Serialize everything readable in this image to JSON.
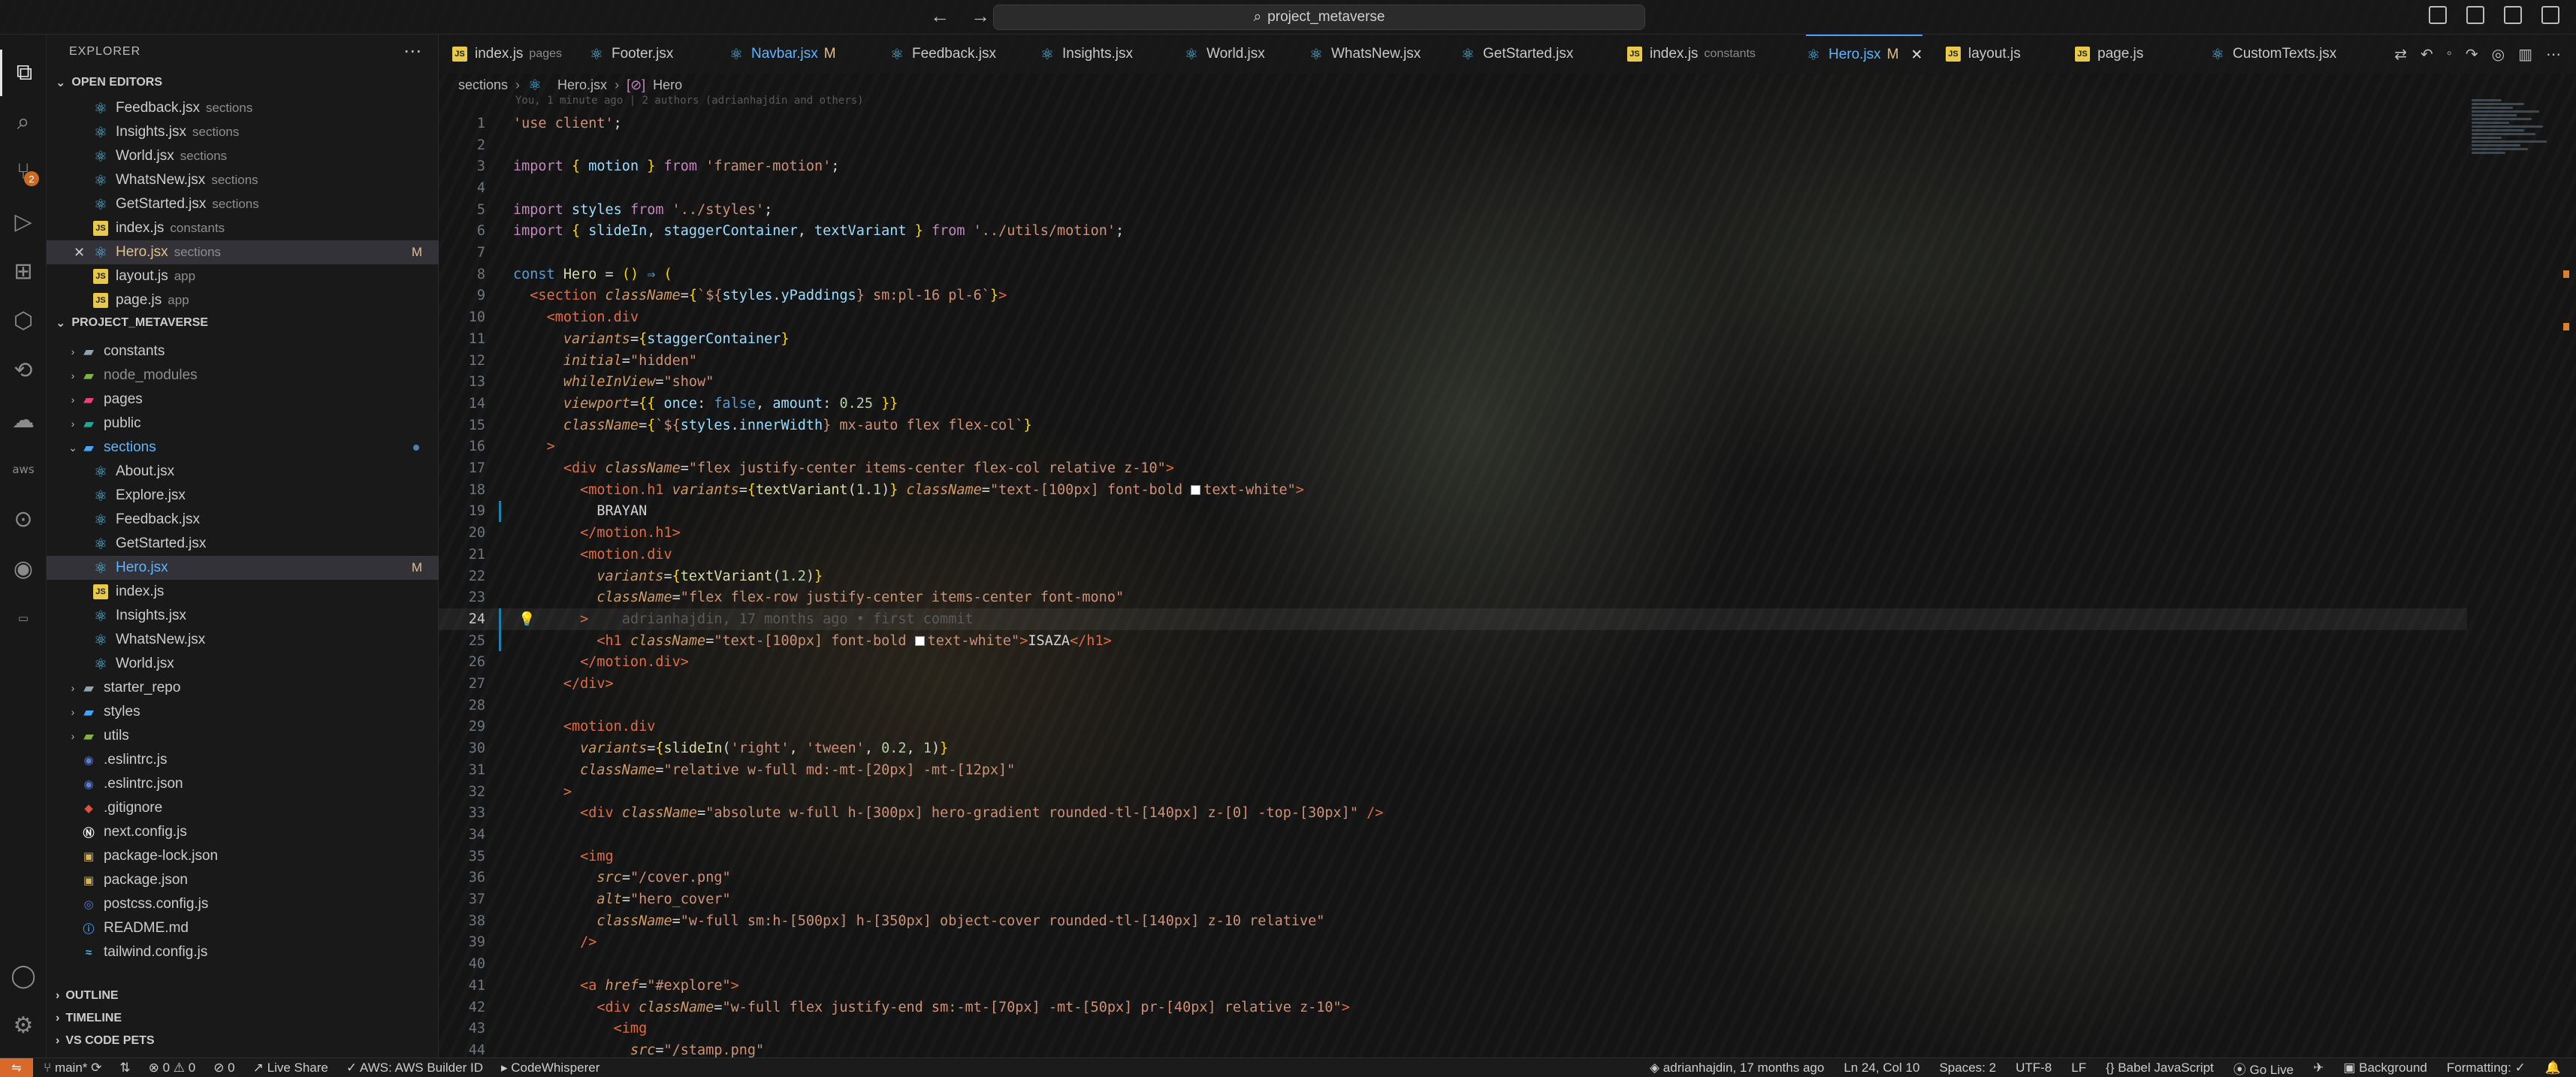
{
  "window": {
    "search_text": "project_metaverse"
  },
  "explorer": {
    "title": "EXPLORER",
    "open_editors_label": "OPEN EDITORS",
    "open_editors": [
      {
        "name": "Feedback.jsx",
        "desc": "sections",
        "icon": "react-icon"
      },
      {
        "name": "Insights.jsx",
        "desc": "sections",
        "icon": "react-icon"
      },
      {
        "name": "World.jsx",
        "desc": "sections",
        "icon": "react-icon"
      },
      {
        "name": "WhatsNew.jsx",
        "desc": "sections",
        "icon": "react-icon"
      },
      {
        "name": "GetStarted.jsx",
        "desc": "sections",
        "icon": "react-icon"
      },
      {
        "name": "index.js",
        "desc": "constants",
        "icon": "js-icon"
      },
      {
        "name": "Hero.jsx",
        "desc": "sections",
        "icon": "react-icon",
        "modified": "M"
      },
      {
        "name": "layout.js",
        "desc": "app",
        "icon": "js-icon"
      },
      {
        "name": "page.js",
        "desc": "app",
        "icon": "js-icon"
      }
    ],
    "project_label": "PROJECT_METAVERSE",
    "tree": [
      {
        "name": "constants",
        "type": "folder"
      },
      {
        "name": "node_modules",
        "type": "folder"
      },
      {
        "name": "pages",
        "type": "folder"
      },
      {
        "name": "public",
        "type": "folder"
      },
      {
        "name": "sections",
        "type": "folder-open"
      },
      {
        "name": "About.jsx",
        "type": "react"
      },
      {
        "name": "Explore.jsx",
        "type": "react"
      },
      {
        "name": "Feedback.jsx",
        "type": "react"
      },
      {
        "name": "GetStarted.jsx",
        "type": "react"
      },
      {
        "name": "Hero.jsx",
        "type": "react",
        "modified": "M"
      },
      {
        "name": "index.js",
        "type": "js"
      },
      {
        "name": "Insights.jsx",
        "type": "react"
      },
      {
        "name": "WhatsNew.jsx",
        "type": "react"
      },
      {
        "name": "World.jsx",
        "type": "react"
      },
      {
        "name": "starter_repo",
        "type": "folder"
      },
      {
        "name": "styles",
        "type": "folder"
      },
      {
        "name": "utils",
        "type": "folder"
      },
      {
        "name": ".eslintrc.js",
        "type": "cfg"
      },
      {
        "name": ".eslintrc.json",
        "type": "cfg"
      },
      {
        "name": ".gitignore",
        "type": "git"
      },
      {
        "name": "next.config.js",
        "type": "n"
      },
      {
        "name": "package-lock.json",
        "type": "json"
      },
      {
        "name": "package.json",
        "type": "json"
      },
      {
        "name": "postcss.config.js",
        "type": "cfg"
      },
      {
        "name": "README.md",
        "type": "info"
      },
      {
        "name": "tailwind.config.js",
        "type": "tw"
      }
    ],
    "outline_label": "OUTLINE",
    "timeline_label": "TIMELINE",
    "vscode_pets_label": "VS CODE PETS"
  },
  "tabs": [
    {
      "name": "index.js",
      "desc": "pages"
    },
    {
      "name": "Footer.jsx",
      "desc": ""
    },
    {
      "name": "Navbar.jsx",
      "desc": "",
      "modified": "M"
    },
    {
      "name": "Feedback.jsx",
      "desc": ""
    },
    {
      "name": "Insights.jsx",
      "desc": ""
    },
    {
      "name": "World.jsx",
      "desc": ""
    },
    {
      "name": "WhatsNew.jsx",
      "desc": ""
    },
    {
      "name": "GetStarted.jsx",
      "desc": ""
    },
    {
      "name": "index.js",
      "desc": "constants"
    },
    {
      "name": "Hero.jsx",
      "desc": "",
      "modified": "M",
      "active": true
    },
    {
      "name": "layout.js",
      "desc": ""
    },
    {
      "name": "page.js",
      "desc": ""
    },
    {
      "name": "CustomTexts.jsx",
      "desc": ""
    }
  ],
  "breadcrumb": {
    "folder": "sections",
    "file": "Hero.jsx",
    "symbol": "Hero"
  },
  "editor": {
    "blame_hint": "You, 1 minute ago | 2 authors (adrianhajdin and others)",
    "current_line": 24,
    "inline_blame": "adrianhajdin, 17 months ago • first commit",
    "line_numbers": [
      "1",
      "2",
      "3",
      "4",
      "5",
      "6",
      "7",
      "8",
      "9",
      "10",
      "11",
      "12",
      "13",
      "14",
      "15",
      "16",
      "17",
      "18",
      "19",
      "20",
      "21",
      "22",
      "23",
      "24",
      "25",
      "26",
      "27",
      "28",
      "29",
      "30",
      "31",
      "32",
      "33",
      "34",
      "35",
      "36",
      "37",
      "38",
      "39",
      "40",
      "41",
      "42",
      "43",
      "44"
    ]
  },
  "status": {
    "branch": "main*",
    "problems": "0 ⚠ 0",
    "ports": "0",
    "live_share": "Live Share",
    "aws": "AWS: AWS Builder ID",
    "codewhisperer": "CodeWhisperer",
    "blame": "adrianhajdin, 17 months ago",
    "position": "Ln 24, Col 10",
    "spaces": "Spaces: 2",
    "encoding": "UTF-8",
    "eol": "LF",
    "language": "Babel JavaScript",
    "golive": "Go Live",
    "background": "Background",
    "formatting": "Formatting: ✓"
  }
}
